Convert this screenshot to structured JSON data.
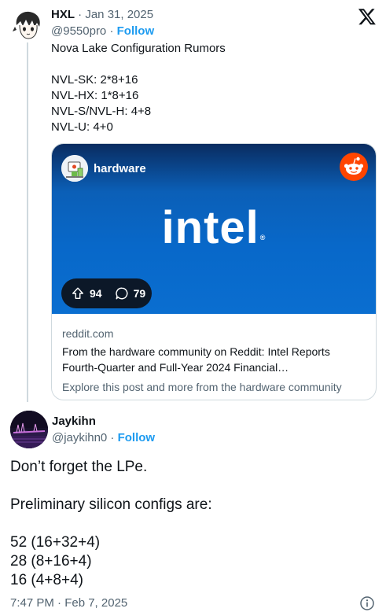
{
  "original_tweet": {
    "author_name": "HXL",
    "date": "Jan 31, 2025",
    "separator": " · ",
    "handle": "@9550pro",
    "follow_label": "Follow",
    "text_lines": [
      "Nova Lake Configuration Rumors",
      "",
      "NVL-SK: 2*8+16",
      "NVL-HX: 1*8+16",
      "NVL-S/NVL-H: 4+8",
      "NVL-U: 4+0"
    ]
  },
  "link_card": {
    "subreddit": "hardware",
    "brand_word": "intel",
    "brand_mark": "®",
    "upvotes": "94",
    "comments": "79",
    "domain": "reddit.com",
    "title_line1": "From the hardware community on Reddit: Intel Reports",
    "title_line2": "Fourth-Quarter and Full-Year 2024 Financial…",
    "description": "Explore this post and more from the hardware community",
    "media_gradient": [
      "#0a2c60",
      "#0868c9"
    ]
  },
  "reply_tweet": {
    "author_name": "Jaykihn",
    "handle": "@jaykihn0",
    "separator": " · ",
    "follow_label": "Follow",
    "text_lines": [
      "Don’t forget the LPe.",
      "",
      "Preliminary silicon configs are:",
      "",
      "52 (16+32+4)",
      "28 (8+16+4)",
      "16 (4+8+4)"
    ],
    "timestamp": "7:47 PM · Feb 7, 2025"
  },
  "colors": {
    "text": "#0f1419",
    "muted": "#536471",
    "accent": "#1d9bf0",
    "border": "#cfd9de",
    "reddit": "#ff4500"
  },
  "icons": [
    "x-logo-icon",
    "upvote-icon",
    "comment-icon",
    "reddit-logo-icon",
    "info-icon"
  ]
}
